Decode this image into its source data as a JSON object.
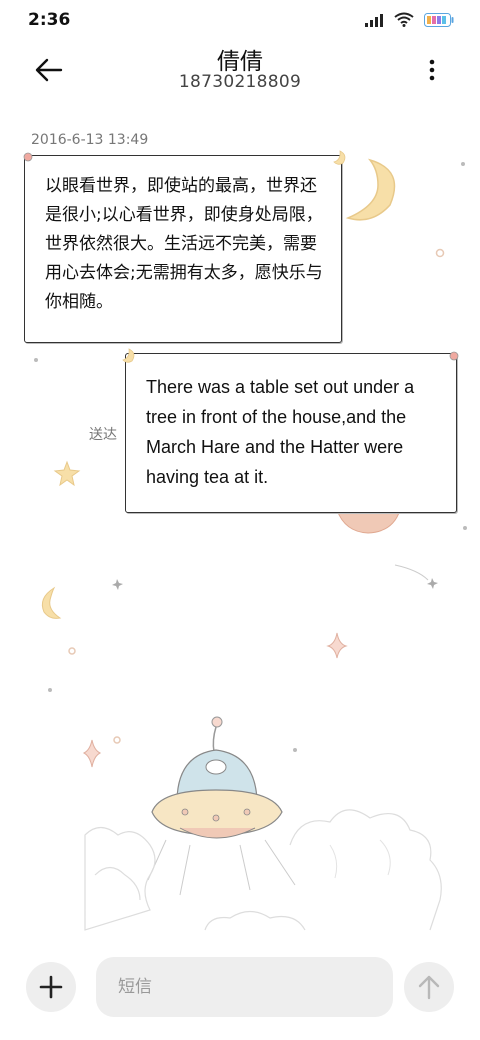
{
  "status_bar": {
    "time": "2:36",
    "icons": [
      "signal-icon",
      "wifi-icon",
      "battery-icon"
    ]
  },
  "header": {
    "contact_name": "倩倩",
    "phone_number": "18730218809",
    "back_icon": "arrow-left-icon",
    "menu_icon": "more-vertical-icon"
  },
  "conversation": {
    "timestamp": "2016-6-13 13:49",
    "messages": [
      {
        "direction": "received",
        "text": "以眼看世界，即使站的最高，世界还是很小;以心看世界，即使身处局限，世界依然很大。生活远不完美，需要用心去体会;无需拥有太多，愿快乐与你相随。"
      },
      {
        "direction": "sent",
        "text": "There was a table set out under a tree in front of the house,and the March Hare and the Hatter were having tea at it.",
        "status": "送达"
      }
    ]
  },
  "composer": {
    "placeholder": "短信",
    "value": "",
    "add_icon": "plus-icon",
    "send_icon": "arrow-up-icon"
  },
  "colors": {
    "background": "#ffffff",
    "input_background": "#eeeeee",
    "bubble_border": "#333333",
    "moon": "#f7dfa8",
    "ufo_dome": "#cfe3ea",
    "planet": "#f0c9b6"
  }
}
